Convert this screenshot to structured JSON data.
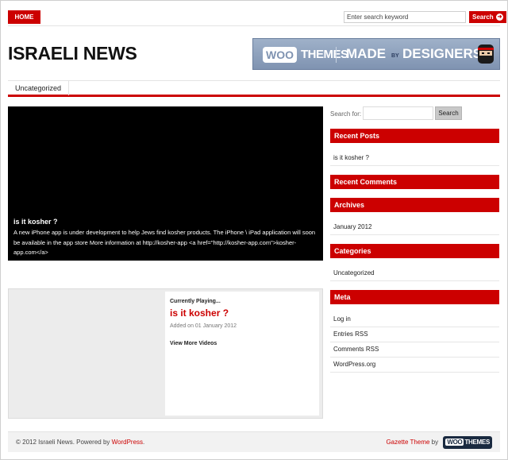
{
  "nav": {
    "home": "HOME"
  },
  "top_search": {
    "placeholder": "Enter search keyword",
    "button": "Search"
  },
  "header": {
    "logo": "ISRAELI NEWS"
  },
  "banner": {
    "woo": "WOO",
    "themes": "THEMES",
    "made": "MADE",
    "by": "BY",
    "designers": "DESIGNERS"
  },
  "categories": [
    {
      "label": "Uncategorized"
    }
  ],
  "featured": {
    "title": "is it kosher ?",
    "excerpt": "A new iPhone app is under development to help Jews find kosher products. The iPhone \\ iPad application will soon be available in the app store More information at http://kosher-app    <a href=\"http://kosher-app.com\">kosher-app.com</a>"
  },
  "video": {
    "label": "Currently Playing...",
    "title": "is it kosher ?",
    "date": "Added on 01 January 2012",
    "more": "View More Videos"
  },
  "sidebar": {
    "search_label": "Search for:",
    "search_button": "Search",
    "recent_posts": {
      "title": "Recent Posts",
      "items": [
        "is it kosher ?"
      ]
    },
    "recent_comments": {
      "title": "Recent Comments"
    },
    "archives": {
      "title": "Archives",
      "items": [
        "January 2012"
      ]
    },
    "categories": {
      "title": "Categories",
      "items": [
        "Uncategorized"
      ]
    },
    "meta": {
      "title": "Meta",
      "items": [
        "Log in",
        "Entries RSS",
        "Comments RSS",
        "WordPress.org"
      ]
    }
  },
  "footer": {
    "copyright": "© 2012 Israeli News. Powered by ",
    "wordpress": "WordPress",
    "period": ".",
    "theme": "Gazette Theme",
    "by": " by ",
    "woo_w": "WOO",
    "woo_t": "THEMES"
  },
  "colors": {
    "accent": "#cc0000",
    "dark": "#111111"
  }
}
